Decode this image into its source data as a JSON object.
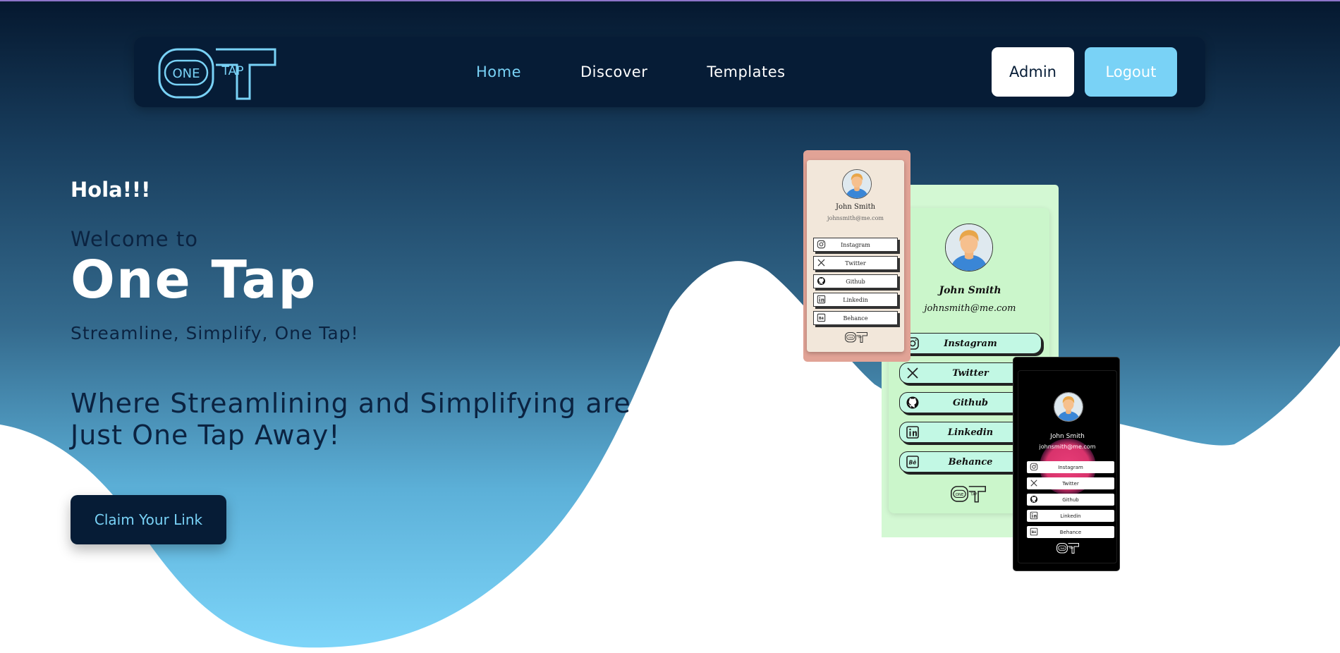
{
  "nav": {
    "logo_text": {
      "one": "ONE",
      "tap": "TAP"
    },
    "links": [
      {
        "label": "Home",
        "active": true
      },
      {
        "label": "Discover",
        "active": false
      },
      {
        "label": "Templates",
        "active": false
      }
    ],
    "admin_label": "Admin",
    "logout_label": "Logout"
  },
  "hero": {
    "greeting": "Hola!!!",
    "welcome": "Welcome to",
    "brand": "One Tap",
    "tagline": "Streamline, Simplify, One Tap!",
    "headline": "Where Streamlining and Simplifying are Just One Tap Away!",
    "cta_label": "Claim Your Link"
  },
  "cards": {
    "peach": {
      "name": "John Smith",
      "email": "johnsmith@me.com",
      "links": [
        "Instagram",
        "Twitter",
        "Github",
        "Linkedin",
        "Behance"
      ]
    },
    "green": {
      "name": "John Smith",
      "email": "johnsmith@me.com",
      "links": [
        "Instagram",
        "Twitter",
        "Github",
        "Linkedin",
        "Behance"
      ]
    },
    "dark": {
      "name": "John Smith",
      "email": "johnsmith@me.com",
      "links": [
        "Instagram",
        "Twitter",
        "Github",
        "Linkedin",
        "Behance"
      ]
    }
  },
  "icons": [
    "instagram-icon",
    "twitter-x-icon",
    "github-icon",
    "linkedin-icon",
    "behance-icon"
  ],
  "colors": {
    "navy": "#061c36",
    "accent": "#79d2f6",
    "gradient_top": "#0b2341",
    "gradient_bottom": "#7bd4f8",
    "card_peach": "#e1a396",
    "card_green": "#d3f8d3",
    "card_dark": "#000000"
  }
}
